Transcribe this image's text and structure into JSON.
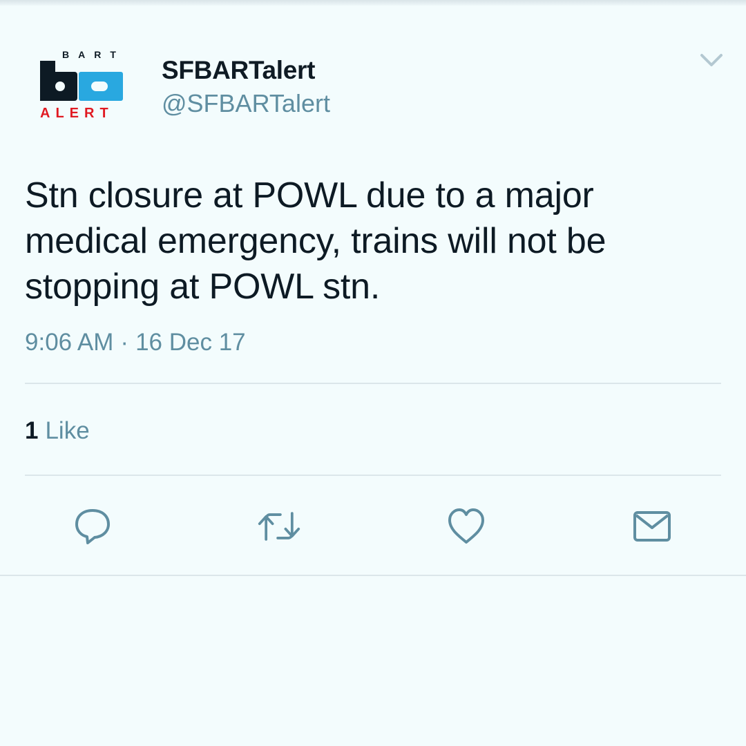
{
  "account": {
    "display_name": "SFBARTalert",
    "handle": "@SFBARTalert",
    "avatar_logo": {
      "top_text": "BART",
      "mark_text": "ba",
      "bottom_text": "ALERT"
    }
  },
  "tweet": {
    "text": "Stn closure at POWL due to a major medical emergency, trains will not be stopping at POWL stn.",
    "time": "9:06 AM",
    "separator": "·",
    "date": "16 Dec 17"
  },
  "engagement": {
    "likes_count": "1",
    "likes_label": "Like"
  },
  "actions": [
    {
      "name": "reply",
      "icon": "speech-bubble-icon"
    },
    {
      "name": "retweet",
      "icon": "retweet-arrows-icon"
    },
    {
      "name": "like",
      "icon": "heart-icon"
    },
    {
      "name": "direct-message",
      "icon": "envelope-icon"
    }
  ],
  "colors": {
    "background": "#f3fcfd",
    "text": "#0d1a24",
    "secondary_text": "#5f8ea1",
    "icon": "#5f8ea1",
    "divider": "#dbe6ea",
    "logo_blue": "#29a8e0",
    "logo_red": "#e01a22"
  }
}
